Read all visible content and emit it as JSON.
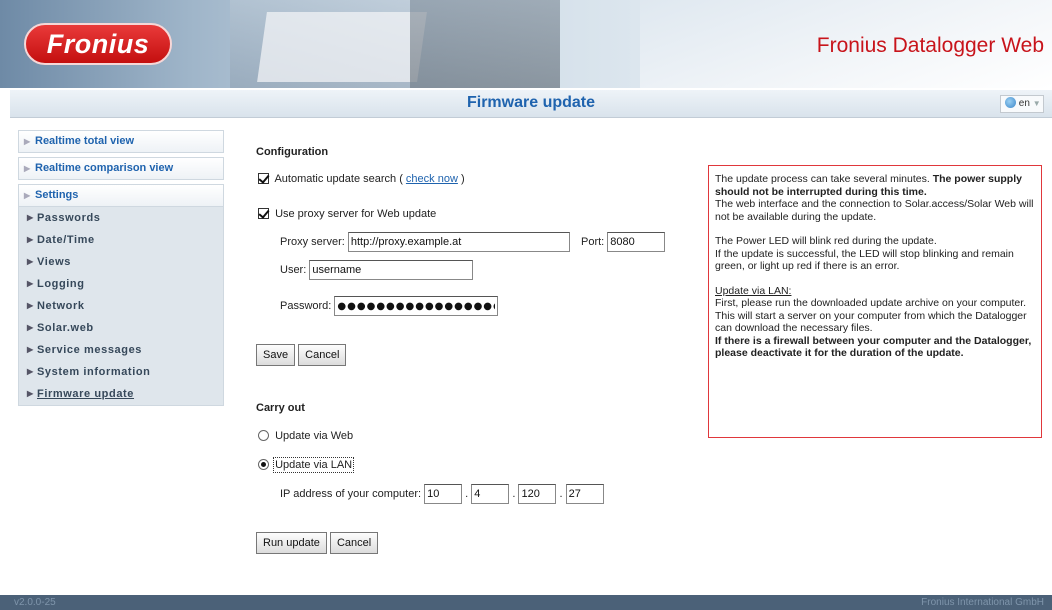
{
  "header": {
    "logo_text": "Fronius",
    "app_title": "Fronius Datalogger Web"
  },
  "titlebar": {
    "page_title": "Firmware update",
    "language": "en"
  },
  "sidebar": {
    "main_items": [
      {
        "label": "Realtime total view"
      },
      {
        "label": "Realtime comparison view"
      },
      {
        "label": "Settings"
      }
    ],
    "sub_items": [
      {
        "label": "Passwords"
      },
      {
        "label": "Date/Time"
      },
      {
        "label": "Views"
      },
      {
        "label": "Logging"
      },
      {
        "label": "Network"
      },
      {
        "label": "Solar.web"
      },
      {
        "label": "Service messages"
      },
      {
        "label": "System information"
      },
      {
        "label": "Firmware update",
        "active": true
      }
    ]
  },
  "configuration": {
    "heading": "Configuration",
    "auto_update_label": "Automatic update search (",
    "check_now": "check now",
    "auto_update_suffix": ")",
    "auto_update_checked": true,
    "proxy_label": "Use proxy server for Web update",
    "proxy_checked": true,
    "proxy_server_label": "Proxy server:",
    "proxy_server_value": "http://proxy.example.at",
    "port_label": "Port:",
    "port_value": "8080",
    "user_label": "User:",
    "user_value": "username",
    "password_label": "Password:",
    "password_value": "●●●●●●●●●●●●●●●●●",
    "save_button": "Save",
    "cancel_button": "Cancel"
  },
  "carry_out": {
    "heading": "Carry out",
    "via_web_label": "Update via Web",
    "via_lan_label": "Update via LAN",
    "selected": "Update via LAN",
    "ip_label": "IP address of your computer:",
    "ip": [
      "10",
      "4",
      "120",
      "27"
    ],
    "ip_separator": ".",
    "run_button": "Run update",
    "cancel_button": "Cancel"
  },
  "info_box": {
    "p1_normal": "The update process can take several minutes. ",
    "p1_bold": "The power supply should not be interrupted during this time.",
    "p1_rest": "The web interface and the connection to Solar.access/Solar Web will not be available during the update.",
    "p2_line1": "The Power LED will blink red during the update.",
    "p2_line2": "If the update is successful, the LED will stop blinking and remain green, or light up red if there is an error.",
    "lan_heading": "Update via LAN:",
    "lan_line1": "First, please run the downloaded update archive on your computer.",
    "lan_line2": "This will start a server on your computer from which the Datalogger can download the necessary files.",
    "lan_bold": "If there is a firewall between your computer and the Datalogger, please deactivate it for the duration of the update."
  },
  "footer": {
    "version": "v2.0.0-25",
    "copyright": "Fronius International GmbH"
  },
  "colors": {
    "brand_red": "#c8141b",
    "title_blue": "#1f63ae",
    "footer_bg": "#4b6178",
    "info_border": "#e0373b"
  }
}
